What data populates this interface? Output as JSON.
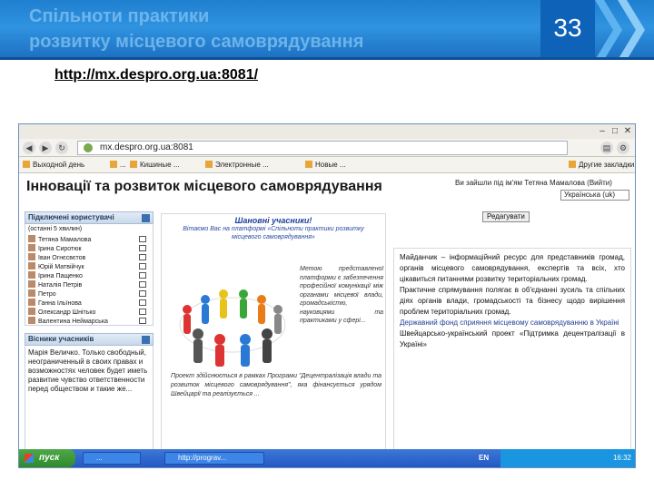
{
  "slide": {
    "title_line1": "Спільноти практики",
    "title_line2": "розвитку місцевого самоврядування",
    "number": "33",
    "url": "http://mx.despro.org.ua:8081/"
  },
  "browser": {
    "address": "mx.despro.org.ua:8081",
    "bookmarks": [
      "Выходной день",
      "...",
      "Кишиные ...",
      "Электронные ...",
      "Новые ..."
    ],
    "bookmarks_other": "Другие закладки"
  },
  "site": {
    "title": "Інновації та розвиток місцевого самоврядування",
    "login_line": "Ви зайшли під ім'ям Тетяна Мамалова (Вийти)",
    "language": "Українська (uk)",
    "edit_button": "Редагувати"
  },
  "users_block": {
    "heading": "Підключені користувачі",
    "note": "(останні 5 хвилин)",
    "users": [
      "Тетяна Мамалова",
      "Ірина Сиротюк",
      "Іван Огнєсвєтов",
      "Юрій Матвійчук",
      "Ірина Пащенко",
      "Наталія Петрів",
      "Петро",
      "Ганна Ільїнова",
      "Олександр Шнітько",
      "Валентина Неймарська"
    ]
  },
  "news_block": {
    "heading": "Вісники учасників",
    "text": "Марія Величко. Только свободный, неограниченный в своих правах и возможностях человек будет иметь развитие чувство ответственности перед обществом и такие же..."
  },
  "center_block": {
    "greeting": "Шановні учасники!",
    "sub": "Вітаємо Вас на платформі «Спільноти практики розвитку місцевого самоврядування»",
    "side_text": "Метою представленої платформи є забезпечення професійної комунікації між органами місцевої влади, громадськістю, науковцями та практиками у сфері...",
    "bottom_text": "Проект здійснюється в рамках Програми \"Децентралізація влади та розвиток місцевого самоврядування\", яка фінансується урядом Швейцарії та реалізується ..."
  },
  "right_block": {
    "text1": "Майданчик – інформаційний ресурс для представників громад, органів місцевого самоврядування, експертів та всіх, хто цікавиться питаннями розвитку територіальних громад.",
    "text2": "Практичне спрямування полягає в об'єднанні зусиль та спільних діях органів влади, громадськості та бізнесу щодо вирішення проблем територіальних громад.",
    "link": "Державний фонд сприяння місцевому самоврядуванню в Україні",
    "text3": "Швейцарсько-український проект «Підтримка децентралізації в Україні»"
  },
  "taskbar": {
    "start": "пуск",
    "tasks": [
      "...",
      "http://prograv..."
    ],
    "lang": "EN",
    "clock": "16:32"
  },
  "colors": {
    "header": "#1f7fd0",
    "number_box": "#0e63b8",
    "taskbar": "#2558c4"
  }
}
